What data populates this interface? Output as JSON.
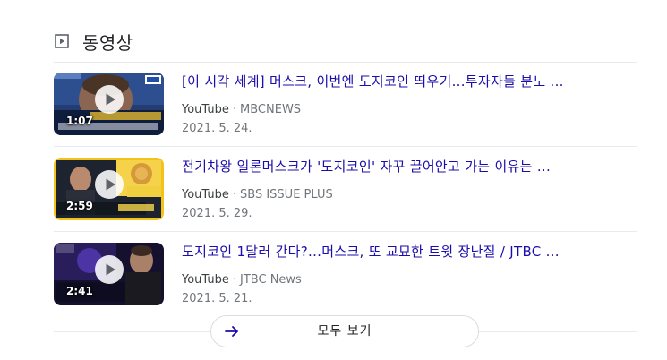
{
  "section": {
    "title": "동영상",
    "icon": "video-icon"
  },
  "videos": [
    {
      "title": "[이 시각 세계] 머스크, 이번엔 도지코인 띄우기...투자자들 분노 ...",
      "source": "YouTube",
      "channel": "MBCNEWS",
      "date": "2021. 5. 24.",
      "duration": "1:07"
    },
    {
      "title": "전기차왕 일론머스크가 '도지코인' 자꾸 끌어안고 가는 이유는 ...",
      "source": "YouTube",
      "channel": "SBS ISSUE PLUS",
      "date": "2021. 5. 29.",
      "duration": "2:59"
    },
    {
      "title": "도지코인 1달러 간다?...머스크, 또 교묘한 트윗 장난질 / JTBC ...",
      "source": "YouTube",
      "channel": "JTBC News",
      "date": "2021. 5. 21.",
      "duration": "2:41"
    }
  ],
  "separator": "·",
  "more_button": {
    "label": "모두 보기",
    "icon": "arrow-right-icon"
  },
  "colors": {
    "link": "#1a0dab",
    "meta": "#70757a",
    "divider": "#e8eaed",
    "accent": "#1a73e8"
  }
}
